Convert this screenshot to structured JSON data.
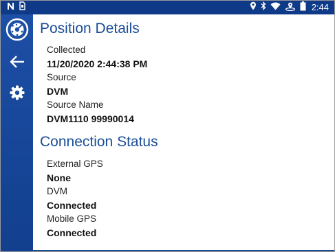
{
  "status_bar": {
    "time": "2:44",
    "icons": [
      "n-icon",
      "sim-card-icon",
      "location-icon",
      "bluetooth-icon",
      "wifi-icon",
      "gps-satellite-icon",
      "battery-icon"
    ]
  },
  "sidebar": {
    "items": [
      {
        "name": "app-logo",
        "icon": "gps-target-icon"
      },
      {
        "name": "back",
        "icon": "back-arrow-icon"
      },
      {
        "name": "settings",
        "icon": "gear-icon"
      }
    ]
  },
  "position_details": {
    "title": "Position Details",
    "collected_label": "Collected",
    "collected_value": "11/20/2020 2:44:38 PM",
    "source_label": "Source",
    "source_value": "DVM",
    "source_name_label": "Source Name",
    "source_name_value": "DVM1110 99990014"
  },
  "connection_status": {
    "title": "Connection Status",
    "external_gps_label": "External GPS",
    "external_gps_value": "None",
    "dvm_label": "DVM",
    "dvm_value": "Connected",
    "mobile_gps_label": "Mobile GPS",
    "mobile_gps_value": "Connected"
  },
  "colors": {
    "status_bar": "#0f3a88",
    "sidebar": "#1d4fa6",
    "accent": "#1a4d96"
  }
}
